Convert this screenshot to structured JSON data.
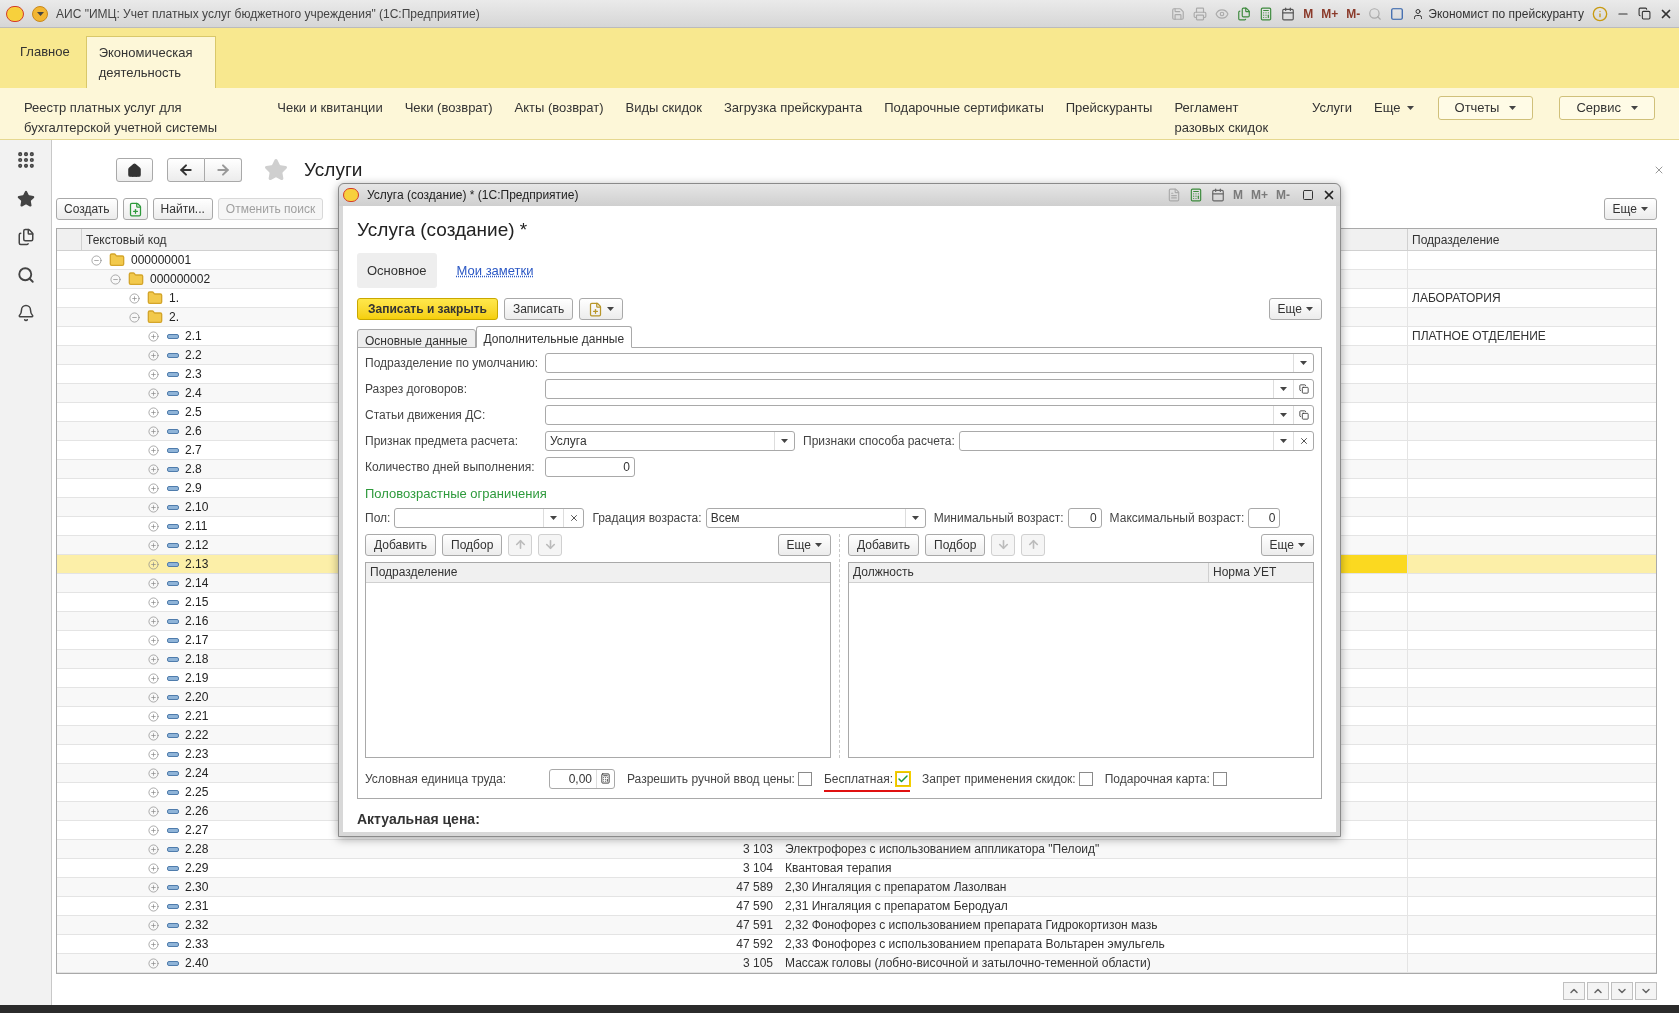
{
  "app_title": "АИС \"ИМЦ: Учет платных услуг бюджетного учреждения\"  (1С:Предприятие)",
  "toolbar": {
    "memory": [
      "M",
      "M+",
      "M-"
    ],
    "user": "Экономист по прейскуранту"
  },
  "sections": [
    {
      "label": "Главное",
      "selected": false
    },
    {
      "label": "Экономическая деятельность",
      "selected": true
    }
  ],
  "nav_links": [
    "Реестр платных услуг для бухгалтерской учетной системы",
    "Чеки и квитанции",
    "Чеки (возврат)",
    "Акты (возврат)",
    "Виды скидок",
    "Загрузка прейскуранта",
    "Подарочные сертификаты",
    "Прейскуранты",
    "Регламент разовых скидок",
    "Услуги"
  ],
  "nav_more": "Еще",
  "nav_menus": [
    "Отчеты",
    "Сервис"
  ],
  "list": {
    "title": "Услуги",
    "buttons": [
      {
        "kind": "text",
        "label": "Создать",
        "disabled": false
      },
      {
        "kind": "icon",
        "disabled": false
      },
      {
        "kind": "text",
        "label": "Найти...",
        "disabled": false
      },
      {
        "kind": "text",
        "label": "Отменить поиск",
        "disabled": true
      }
    ],
    "more": "Еще",
    "columns": {
      "column_1": "Текстовый код",
      "department": "Подразделение"
    },
    "rows": [
      {
        "label": "000000001",
        "kind": "folder",
        "expanded": true,
        "selected": false,
        "children": [
          {
            "label": "000000002",
            "kind": "folder",
            "expanded": true,
            "selected": false,
            "children": [
              {
                "label": "1.",
                "kind": "folder",
                "expanded": false,
                "selected": false,
                "department": "ЛАБОРАТОРИЯ"
              },
              {
                "label": "2.",
                "kind": "folder",
                "expanded": true,
                "selected": false,
                "children": [
                  {
                    "label": "2.1",
                    "kind": "item",
                    "expanded": false,
                    "selected": false,
                    "department": "ПЛАТНОЕ ОТДЕЛЕНИЕ"
                  },
                  {
                    "label": "2.2",
                    "kind": "item",
                    "expanded": false,
                    "selected": false
                  },
                  {
                    "label": "2.3",
                    "kind": "item",
                    "expanded": false,
                    "selected": false
                  },
                  {
                    "label": "2.4",
                    "kind": "item",
                    "expanded": false,
                    "selected": false
                  },
                  {
                    "label": "2.5",
                    "kind": "item",
                    "expanded": false,
                    "selected": false
                  },
                  {
                    "label": "2.6",
                    "kind": "item",
                    "expanded": false,
                    "selected": false
                  },
                  {
                    "label": "2.7",
                    "kind": "item",
                    "expanded": false,
                    "selected": false
                  },
                  {
                    "label": "2.8",
                    "kind": "item",
                    "expanded": false,
                    "selected": false
                  },
                  {
                    "label": "2.9",
                    "kind": "item",
                    "expanded": false,
                    "selected": false
                  },
                  {
                    "label": "2.10",
                    "kind": "item",
                    "expanded": false,
                    "selected": false
                  },
                  {
                    "label": "2.11",
                    "kind": "item",
                    "expanded": false,
                    "selected": false
                  },
                  {
                    "label": "2.12",
                    "kind": "item",
                    "expanded": false,
                    "selected": false
                  },
                  {
                    "label": "2.13",
                    "kind": "item",
                    "expanded": false,
                    "selected": true
                  },
                  {
                    "label": "2.14",
                    "kind": "item",
                    "expanded": false,
                    "selected": false
                  },
                  {
                    "label": "2.15",
                    "kind": "item",
                    "expanded": false,
                    "selected": false
                  },
                  {
                    "label": "2.16",
                    "kind": "item",
                    "expanded": false,
                    "selected": false
                  },
                  {
                    "label": "2.17",
                    "kind": "item",
                    "expanded": false,
                    "selected": false
                  },
                  {
                    "label": "2.18",
                    "kind": "item",
                    "expanded": false,
                    "selected": false
                  },
                  {
                    "label": "2.19",
                    "kind": "item",
                    "expanded": false,
                    "selected": false
                  },
                  {
                    "label": "2.20",
                    "kind": "item",
                    "expanded": false,
                    "selected": false
                  },
                  {
                    "label": "2.21",
                    "kind": "item",
                    "expanded": false,
                    "selected": false
                  },
                  {
                    "label": "2.22",
                    "kind": "item",
                    "expanded": false,
                    "selected": false
                  },
                  {
                    "label": "2.23",
                    "kind": "item",
                    "expanded": false,
                    "selected": false
                  },
                  {
                    "label": "2.24",
                    "kind": "item",
                    "expanded": false,
                    "selected": false
                  },
                  {
                    "label": "2.25",
                    "kind": "item",
                    "expanded": false,
                    "selected": false
                  },
                  {
                    "label": "2.26",
                    "kind": "item",
                    "expanded": false,
                    "selected": false
                  },
                  {
                    "label": "2.27",
                    "kind": "item",
                    "expanded": false,
                    "selected": false
                  },
                  {
                    "label": "2.28",
                    "kind": "item",
                    "expanded": false,
                    "selected": false,
                    "column_2": "3 103",
                    "column_3": "Электрофорез с использованием аппликатора \"Пелоид\""
                  },
                  {
                    "label": "2.29",
                    "kind": "item",
                    "expanded": false,
                    "selected": false,
                    "column_2": "3 104",
                    "column_3": "Квантовая терапия"
                  },
                  {
                    "label": "2.30",
                    "kind": "item",
                    "expanded": false,
                    "selected": false,
                    "column_2": "47 589",
                    "column_3": "2,30 Ингаляция с препаратом Лазолван"
                  },
                  {
                    "label": "2.31",
                    "kind": "item",
                    "expanded": false,
                    "selected": false,
                    "column_2": "47 590",
                    "column_3": "2,31 Ингаляция с препаратом Беродуал"
                  },
                  {
                    "label": "2.32",
                    "kind": "item",
                    "expanded": false,
                    "selected": false,
                    "column_2": "47 591",
                    "column_3": "2,32 Фонофорез с использованием препарата Гидрокортизон мазь"
                  },
                  {
                    "label": "2.33",
                    "kind": "item",
                    "expanded": false,
                    "selected": false,
                    "column_2": "47 592",
                    "column_3": "2,33 Фонофорез с использованием препарата Вольтарен эмульгель"
                  },
                  {
                    "label": "2.40",
                    "kind": "item",
                    "expanded": false,
                    "selected": false,
                    "column_2": "3 105",
                    "column_3": "Массаж головы (лобно-височной и затылочно-теменной области)"
                  }
                ]
              }
            ]
          }
        ]
      }
    ]
  },
  "dialog": {
    "window_title": "Услуга (создание) *  (1С:Предприятие)",
    "memory": [
      "M",
      "M+",
      "M-"
    ],
    "heading": "Услуга (создание) *",
    "form_tabs": [
      {
        "label": "Основное",
        "selected": true
      },
      {
        "label": "Мои заметки",
        "selected": false
      }
    ],
    "save_close": "Записать и закрыть",
    "save": "Записать",
    "more": "Еще",
    "page_tabs": [
      {
        "label": "Основные данные",
        "selected": false
      },
      {
        "label": "Дополнительные данные",
        "selected": true
      }
    ],
    "form_rows": [
      [
        {
          "label": "Подразделение по умолчанию:",
          "kind": "select"
        }
      ],
      [
        {
          "label": "Разрез договоров:",
          "kind": "select_open"
        }
      ],
      [
        {
          "label": "Статьи движения ДС:",
          "kind": "select_open"
        }
      ],
      [
        {
          "label": "Признак предмета расчета:",
          "kind": "select",
          "value": "Услуга"
        },
        {
          "label": "Признаки способа расчета:",
          "kind": "select_clear"
        }
      ],
      [
        {
          "label": "Количество дней выполнения:",
          "kind": "number",
          "value": "0"
        }
      ]
    ],
    "group_title": "Половозрастные ограничения",
    "group_fields": [
      {
        "label": "Пол:",
        "kind": "select_clear"
      },
      {
        "label": "Градация возраста:",
        "kind": "select",
        "value": "Всем"
      },
      {
        "label": "Минимальный возраст:",
        "kind": "number",
        "value": "0"
      },
      {
        "label": "Максимальный возраст:",
        "kind": "number",
        "value": "0"
      }
    ],
    "tables": [
      {
        "buttons": [
          "Добавить",
          "Подбор"
        ],
        "more": "Еще",
        "columns": [
          "Подразделение"
        ]
      },
      {
        "buttons": [
          "Добавить",
          "Подбор"
        ],
        "more": "Еще",
        "columns": [
          "Должность",
          "Норма УЕТ"
        ]
      }
    ],
    "labor_unit": {
      "label": "Условная единица труда:",
      "value": "0,00"
    },
    "checkboxes": [
      {
        "label": "Разрешить ручной ввод цены:",
        "checked": false,
        "highlighted": false
      },
      {
        "label": "Бесплатная:",
        "checked": true,
        "highlighted": true
      },
      {
        "label": "Запрет применения скидок:",
        "checked": false,
        "highlighted": false
      },
      {
        "label": "Подарочная карта:",
        "checked": false,
        "highlighted": false
      }
    ],
    "price_label": "Актуальная цена:"
  }
}
